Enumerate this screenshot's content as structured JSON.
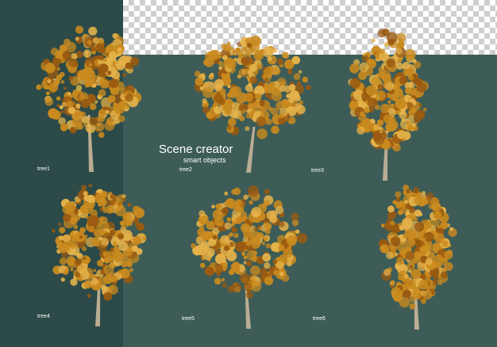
{
  "title": "Scene creator",
  "subtitle": "smart objects",
  "trees": [
    {
      "label": "tree1"
    },
    {
      "label": "tree2"
    },
    {
      "label": "tree3"
    },
    {
      "label": "tree4"
    },
    {
      "label": "tree5"
    },
    {
      "label": "tree6"
    }
  ],
  "colors": {
    "background_main": "#3d5c57",
    "background_left_panel": "#2c4a47",
    "foliage_dark": "#9a5a10",
    "foliage_mid": "#c98a1e",
    "foliage_light": "#e5b24a",
    "trunk": "#b9ad93",
    "label_text": "#ffffff"
  }
}
